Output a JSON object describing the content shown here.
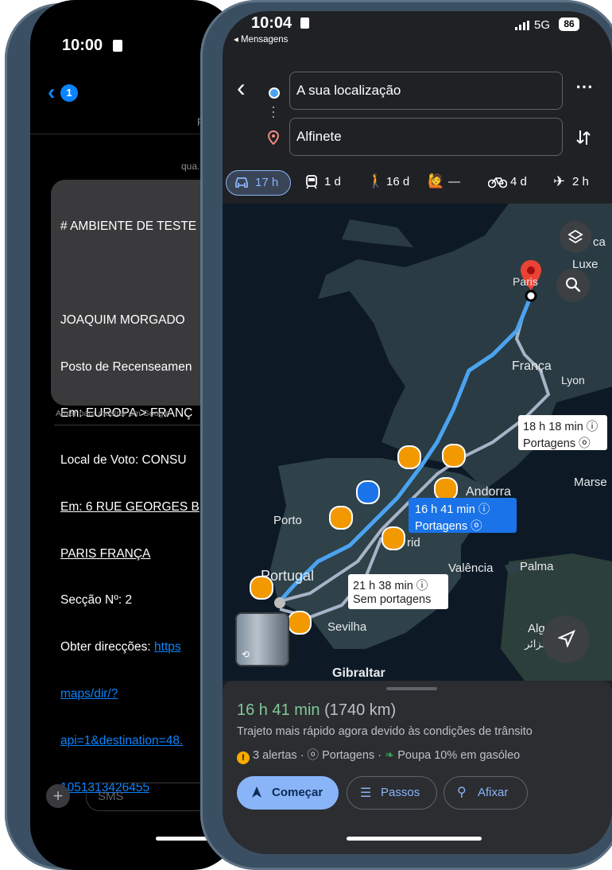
{
  "left_phone": {
    "status_time": "10:00",
    "back_badge": "1",
    "header_cut": "F",
    "date_cut": "qua.",
    "message_lines": [
      "# AMBIENTE DE TESTE",
      "",
      "JOAQUIM MORGADO",
      "Posto de Recenseamen",
      "Em: EUROPA > FRANÇ",
      "Local de Voto: CONSU",
      "Em: 6 RUE GEORGES B",
      "PARIS FRANÇA",
      "Secção Nº: 2",
      "Obter direcções: https",
      "maps/dir/?",
      "api=1&destination=48.",
      "1051313426455"
    ],
    "pin_hint": "Afixar para mostrar em Google",
    "sms_placeholder": "SMS",
    "plus_label": "+"
  },
  "right_phone": {
    "status_time": "10:04",
    "back_app": "◂ Mensagens",
    "network": "5G",
    "battery": "86",
    "origin": "A sua localização",
    "destination": "Alfinete",
    "more_label": "⋯",
    "modes": [
      {
        "icon": "car-icon",
        "label": "17 h"
      },
      {
        "icon": "transit-icon",
        "label": "1 d"
      },
      {
        "icon": "walk-icon",
        "label": "16 d"
      },
      {
        "icon": "ride-icon",
        "label": "—"
      },
      {
        "icon": "bike-icon",
        "label": "4 d"
      },
      {
        "icon": "flight-icon",
        "label": "2 h"
      }
    ],
    "map_labels": {
      "paris": "Paris",
      "luxembourg": "Luxe",
      "ca": "ca",
      "france": "França",
      "lyon": "Lyon",
      "andorra": "Andorra",
      "marseille": "Marse",
      "porto": "Porto",
      "madrid": "rid",
      "portugal": "Portugal",
      "valencia": "Valência",
      "palma": "Palma",
      "sevilla": "Sevilha",
      "algiers": "Alg",
      "algiers_ar": "جزائر",
      "gibraltar": "Gibraltar"
    },
    "route_bubbles": {
      "primary_time": "16 h 41 min ⓘ",
      "primary_sub": "Portagens ⓞ",
      "alt1_time": "18 h 18 min ⓘ",
      "alt1_sub": "Portagens ⓞ",
      "alt2_time": "21 h 38 min ⓘ",
      "alt2_sub": "Sem portagens"
    },
    "sheet": {
      "duration": "16 h 41 min",
      "distance": "(1740 km)",
      "description": "Trajeto mais rápido agora devido às condições de trânsito",
      "alerts": "3 alertas",
      "tolls": "Portagens",
      "fuel": "Poupa 10% em gasóleo",
      "start_label": "Começar",
      "steps_label": "Passos",
      "pin_label": "Afixar"
    },
    "colors": {
      "route_primary": "#4aa3f0",
      "route_alt": "#a8b3c7",
      "accent_button": "#8ab4f8",
      "duration_green": "#81c995",
      "warning": "#f29900"
    }
  }
}
